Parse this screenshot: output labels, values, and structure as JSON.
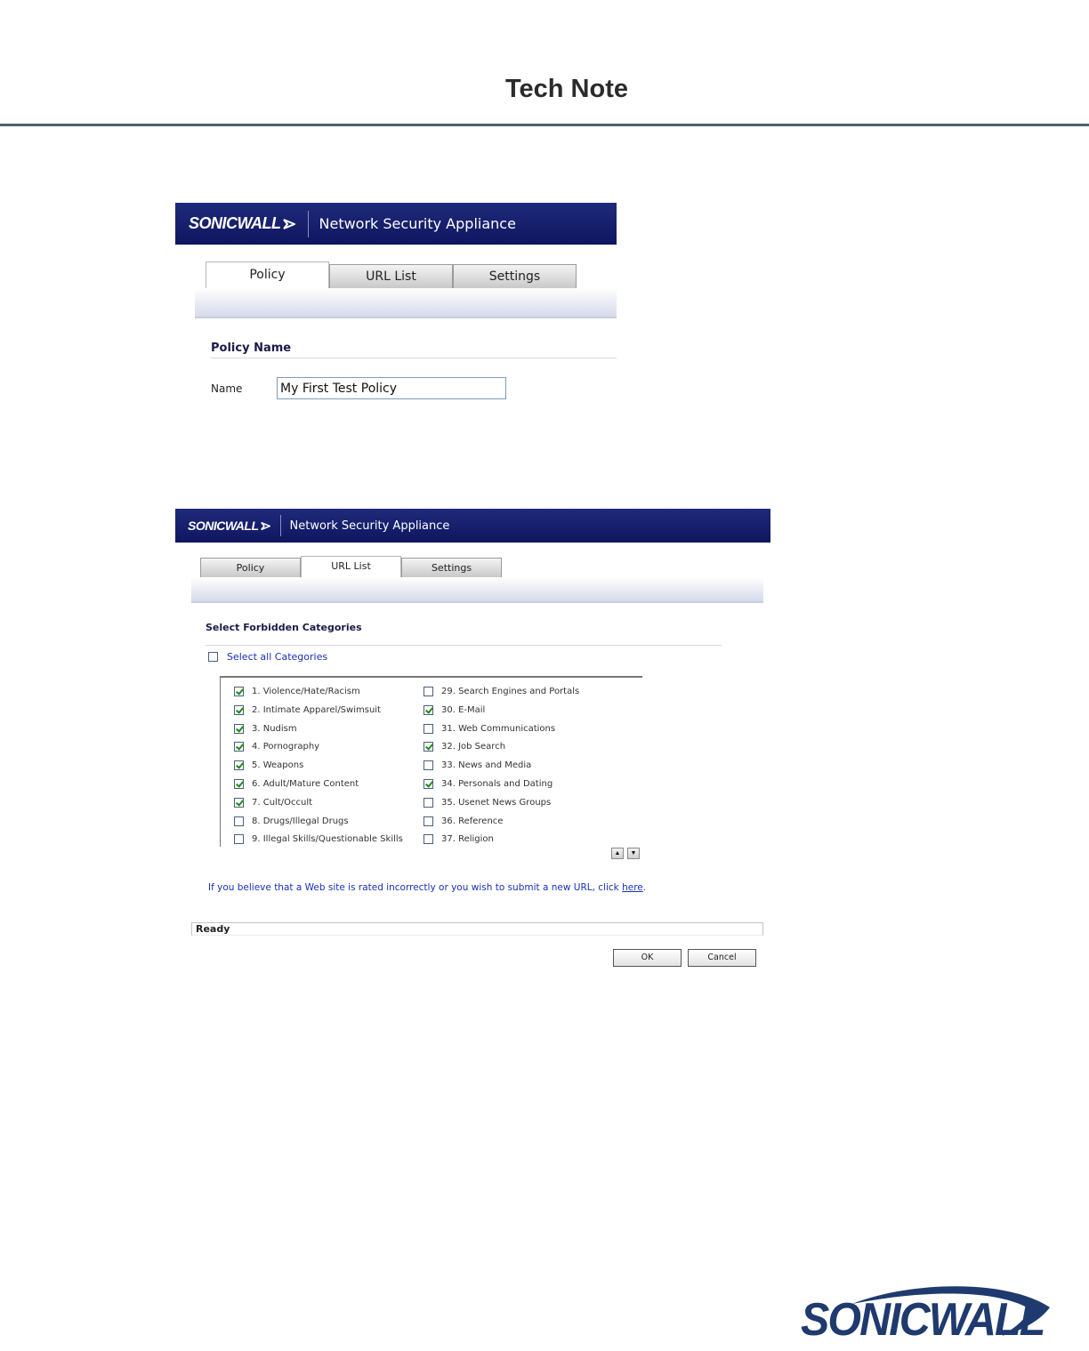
{
  "document": {
    "title": "Tech Note"
  },
  "colors": {
    "banner": "#1a237a",
    "link": "#1b2fb8",
    "check": "#1b8a1b",
    "rule": "#4a6275",
    "logo": "#1e3a6e"
  },
  "screen1": {
    "brand": "SONICWALL",
    "app_title": "Network Security Appliance",
    "tabs": [
      {
        "label": "Policy",
        "active": true
      },
      {
        "label": "URL List",
        "active": false
      },
      {
        "label": "Settings",
        "active": false
      }
    ],
    "section_title": "Policy Name",
    "name_label": "Name",
    "name_value": "My First Test Policy"
  },
  "screen2": {
    "brand": "SONICWALL",
    "app_title": "Network Security Appliance",
    "tabs": [
      {
        "label": "Policy",
        "active": false
      },
      {
        "label": "URL List",
        "active": true
      },
      {
        "label": "Settings",
        "active": false
      }
    ],
    "section_title": "Select Forbidden Categories",
    "select_all_label": "Select all Categories",
    "categories_left": [
      {
        "label": "1. Violence/Hate/Racism",
        "checked": true
      },
      {
        "label": "2. Intimate Apparel/Swimsuit",
        "checked": true
      },
      {
        "label": "3. Nudism",
        "checked": true
      },
      {
        "label": "4. Pornography",
        "checked": true
      },
      {
        "label": "5. Weapons",
        "checked": true
      },
      {
        "label": "6. Adult/Mature Content",
        "checked": true
      },
      {
        "label": "7. Cult/Occult",
        "checked": true
      },
      {
        "label": "8. Drugs/Illegal Drugs",
        "checked": false
      },
      {
        "label": "9. Illegal Skills/Questionable Skills",
        "checked": false
      }
    ],
    "categories_right": [
      {
        "label": "29. Search Engines and Portals",
        "checked": false
      },
      {
        "label": "30. E-Mail",
        "checked": true
      },
      {
        "label": "31. Web Communications",
        "checked": false
      },
      {
        "label": "32. Job Search",
        "checked": true
      },
      {
        "label": "33. News and Media",
        "checked": false
      },
      {
        "label": "34. Personals and Dating",
        "checked": true
      },
      {
        "label": "35. Usenet News Groups",
        "checked": false
      },
      {
        "label": "36. Reference",
        "checked": false
      },
      {
        "label": "37. Religion",
        "checked": false
      }
    ],
    "note_text": "If you believe that a Web site is rated incorrectly or you wish to submit a new URL, click ",
    "note_link": "here",
    "note_end": ".",
    "status": "Ready",
    "ok_label": "OK",
    "cancel_label": "Cancel"
  },
  "footer": {
    "logo_text": "SONICWALL"
  }
}
